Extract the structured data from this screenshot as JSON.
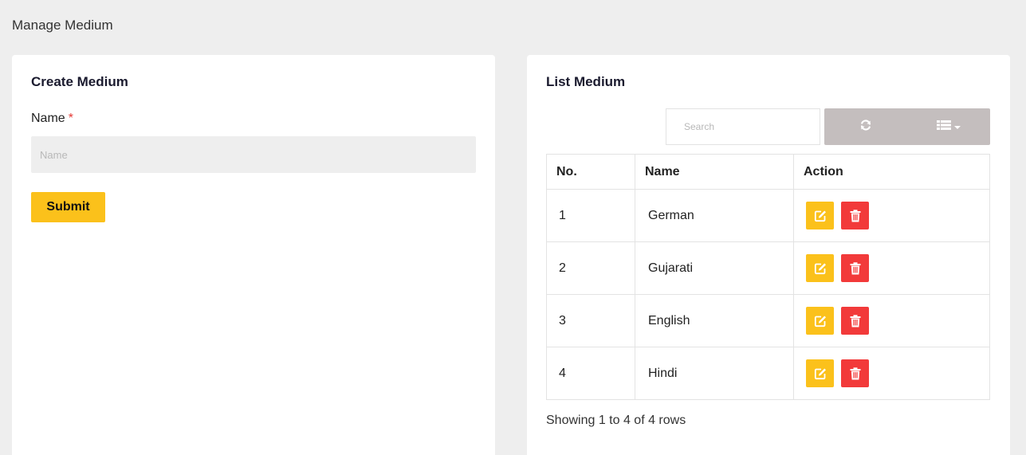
{
  "page": {
    "title": "Manage Medium"
  },
  "create": {
    "title": "Create Medium",
    "name_label": "Name",
    "required_mark": "*",
    "name_placeholder": "Name",
    "name_value": "",
    "submit_label": "Submit"
  },
  "list": {
    "title": "List Medium",
    "search_placeholder": "Search",
    "toolbar_icons": [
      "refresh-icon",
      "columns-list-icon",
      "caret-down-icon"
    ],
    "columns": [
      "No.",
      "Name",
      "Action"
    ],
    "rows": [
      {
        "no": "1",
        "name": "German"
      },
      {
        "no": "2",
        "name": "Gujarati"
      },
      {
        "no": "3",
        "name": "English"
      },
      {
        "no": "4",
        "name": "Hindi"
      }
    ],
    "row_action_icons": [
      "edit-icon",
      "trash-icon"
    ],
    "footer": "Showing 1 to 4 of 4 rows"
  },
  "colors": {
    "background": "#eeeeee",
    "accent": "#fbc11b",
    "danger": "#f23a3a",
    "toolbar": "#c4bebe"
  }
}
